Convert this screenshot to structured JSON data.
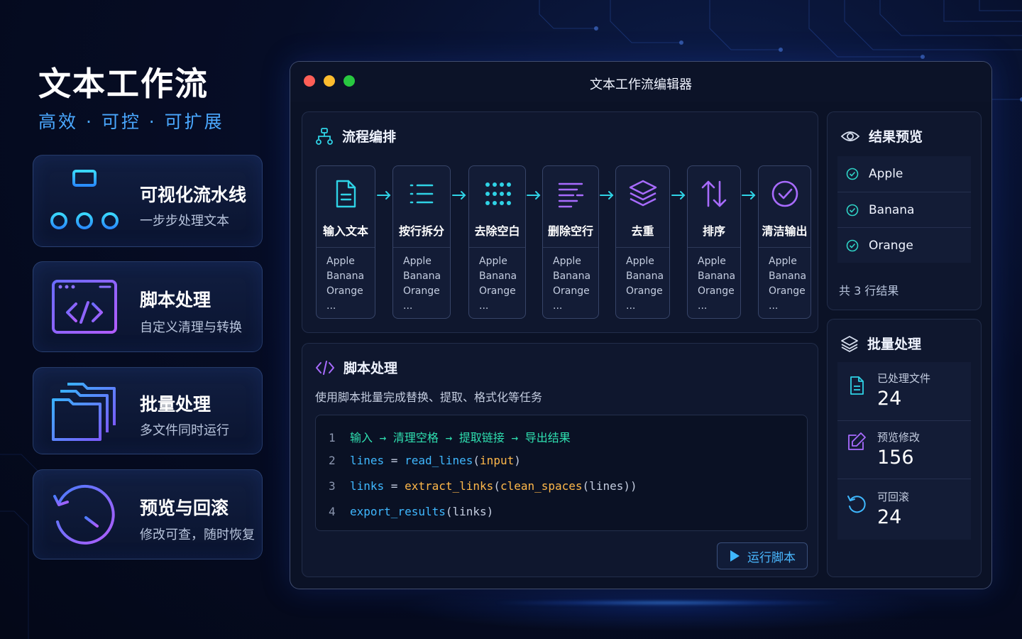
{
  "hero": {
    "title": "文本工作流",
    "subtitle": "高效 · 可控 · 可扩展"
  },
  "features": [
    {
      "title": "可视化流水线",
      "desc": "一步步处理文本",
      "icon": "pipeline-tree-icon"
    },
    {
      "title": "脚本处理",
      "desc": "自定义清理与转换",
      "icon": "code-window-icon"
    },
    {
      "title": "批量处理",
      "desc": "多文件同时运行",
      "icon": "folder-stack-icon"
    },
    {
      "title": "预览与回滚",
      "desc": "修改可查，随时恢复",
      "icon": "history-clock-icon"
    }
  ],
  "window": {
    "title": "文本工作流编辑器"
  },
  "pipeline": {
    "header": "流程编排",
    "nodes": [
      {
        "label": "输入文本",
        "icon": "document-icon",
        "color": "#2fd3e6",
        "items": [
          "Apple",
          "Banana",
          "Orange",
          "..."
        ]
      },
      {
        "label": "按行拆分",
        "icon": "list-icon",
        "color": "#2fd3e6",
        "items": [
          "Apple",
          "Banana",
          "Orange",
          "..."
        ]
      },
      {
        "label": "去除空白",
        "icon": "dots-grid-icon",
        "color": "#2fd3e6",
        "items": [
          "Apple",
          "Banana",
          "Orange",
          "..."
        ]
      },
      {
        "label": "删除空行",
        "icon": "lines-remove-icon",
        "color": "#a86bff",
        "items": [
          "Apple",
          "Banana",
          "Orange",
          "..."
        ]
      },
      {
        "label": "去重",
        "icon": "layers-icon",
        "color": "#a86bff",
        "items": [
          "Apple",
          "Banana",
          "Orange",
          "..."
        ]
      },
      {
        "label": "排序",
        "icon": "sort-arrows-icon",
        "color": "#a86bff",
        "items": [
          "Apple",
          "Banana",
          "Orange",
          "..."
        ]
      },
      {
        "label": "清洁输出",
        "icon": "check-circle-icon",
        "color": "#a86bff",
        "items": [
          "Apple",
          "Banana",
          "Orange",
          "..."
        ]
      }
    ]
  },
  "script": {
    "header": "脚本处理",
    "description": "使用脚本批量完成替换、提取、格式化等任务",
    "lines": [
      {
        "n": "1",
        "parts": [
          {
            "t": "输入",
            "c": "#2fe0b0"
          },
          {
            "t": " → ",
            "c": "#2fe0b0"
          },
          {
            "t": "清理空格",
            "c": "#2fe0b0"
          },
          {
            "t": " → ",
            "c": "#2fe0b0"
          },
          {
            "t": "提取链接",
            "c": "#2fe0b0"
          },
          {
            "t": " → ",
            "c": "#2fe0b0"
          },
          {
            "t": "导出结果",
            "c": "#2fe0b0"
          }
        ]
      },
      {
        "n": "2",
        "parts": [
          {
            "t": "lines",
            "c": "#3fb8ff"
          },
          {
            "t": " = ",
            "c": "#c4cde0"
          },
          {
            "t": "read_lines",
            "c": "#3fb8ff"
          },
          {
            "t": "(",
            "c": "#c4cde0"
          },
          {
            "t": "input",
            "c": "#ffb84a"
          },
          {
            "t": ")",
            "c": "#c4cde0"
          }
        ]
      },
      {
        "n": "3",
        "parts": [
          {
            "t": "links",
            "c": "#3fb8ff"
          },
          {
            "t": " = ",
            "c": "#c4cde0"
          },
          {
            "t": "extract_links",
            "c": "#ffb84a"
          },
          {
            "t": "(",
            "c": "#c4cde0"
          },
          {
            "t": "clean_spaces",
            "c": "#ffb84a"
          },
          {
            "t": "(lines))",
            "c": "#c4cde0"
          }
        ]
      },
      {
        "n": "4",
        "parts": [
          {
            "t": "export_results",
            "c": "#3fb8ff"
          },
          {
            "t": "(links)",
            "c": "#c4cde0"
          }
        ]
      }
    ],
    "run_label": "运行脚本"
  },
  "preview": {
    "header": "结果预览",
    "results": [
      "Apple",
      "Banana",
      "Orange"
    ],
    "summary": "共 3 行结果"
  },
  "batch": {
    "header": "批量处理",
    "stats": [
      {
        "label": "已处理文件",
        "value": "24",
        "icon": "file-icon"
      },
      {
        "label": "预览修改",
        "value": "156",
        "icon": "edit-icon"
      },
      {
        "label": "可回滚",
        "value": "24",
        "icon": "undo-icon"
      }
    ]
  },
  "colors": {
    "cyan": "#2fd3e6",
    "purple": "#a86bff",
    "blue": "#4aa8ff"
  }
}
